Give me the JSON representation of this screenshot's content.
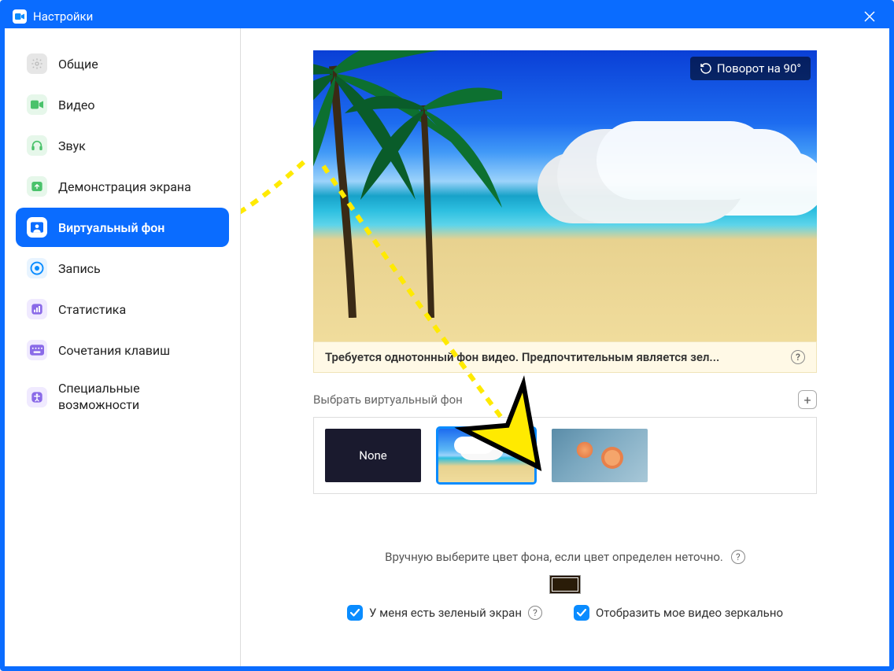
{
  "window": {
    "title": "Настройки"
  },
  "sidebar": {
    "items": [
      {
        "label": "Общие"
      },
      {
        "label": "Видео"
      },
      {
        "label": "Звук"
      },
      {
        "label": "Демонстрация экрана"
      },
      {
        "label": "Виртуальный фон"
      },
      {
        "label": "Запись"
      },
      {
        "label": "Статистика"
      },
      {
        "label": "Сочетания клавиш"
      },
      {
        "label": "Специальные возможности"
      }
    ]
  },
  "main": {
    "rotate_label": "Поворот на 90°",
    "notice": "Требуется однотонный фон видео. Предпочтительным является зел...",
    "choose_label": "Выбрать виртуальный фон",
    "thumb_none": "None",
    "color_hint": "Вручную выберите цвет фона, если цвет определен неточно.",
    "cb_green": "У меня есть зеленый экран",
    "cb_mirror": "Отобразить мое видео зеркально"
  }
}
